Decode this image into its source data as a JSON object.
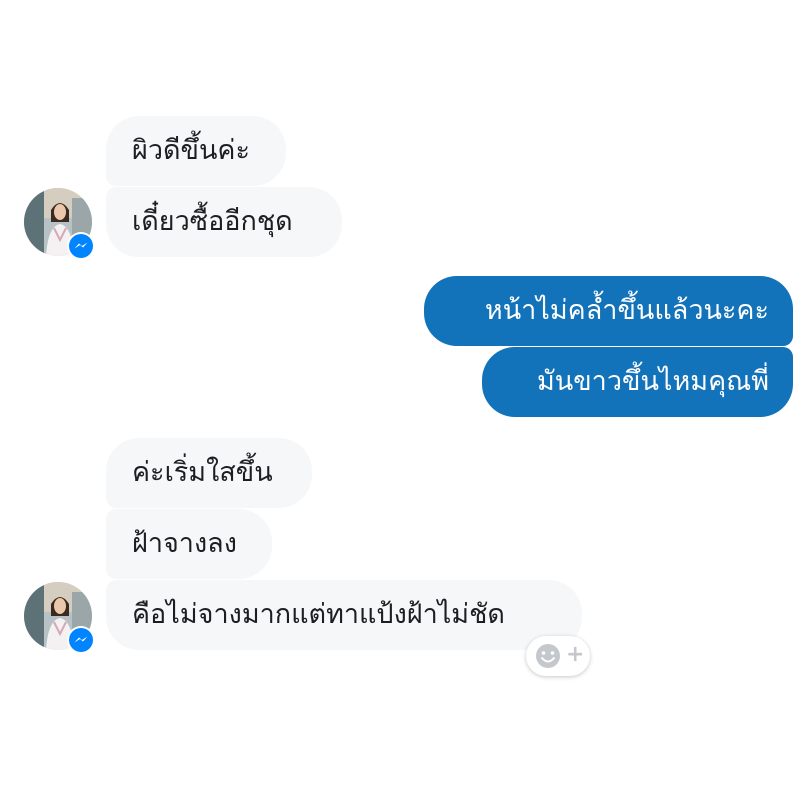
{
  "conversation": {
    "messages": [
      {
        "direction": "incoming",
        "text": "ผิวดีขึ้นค่ะ"
      },
      {
        "direction": "incoming",
        "text": "เดี๋ยวซื้ออีกชุด"
      },
      {
        "direction": "outgoing",
        "text": "หน้าไม่คล้ำขึ้นแล้วนะคะ"
      },
      {
        "direction": "outgoing",
        "text": "มันขาวขึ้นไหมคุณพี่"
      },
      {
        "direction": "incoming",
        "text": "ค่ะเริ่มใสขึ้น"
      },
      {
        "direction": "incoming",
        "text": "ฝ้าจางลง"
      },
      {
        "direction": "incoming",
        "text": "คือไม่จางมากแต่ทาแป้งฝ้าไม่ชัด"
      }
    ]
  },
  "colors": {
    "outgoing_bubble": "#1272ba",
    "incoming_bubble": "#f6f7f9",
    "messenger_badge": "#0084ff"
  },
  "icons": {
    "avatar": "contact-avatar",
    "badge": "messenger-icon",
    "reaction": "add-reaction-icon"
  },
  "reaction_button": {
    "plus": "+"
  }
}
